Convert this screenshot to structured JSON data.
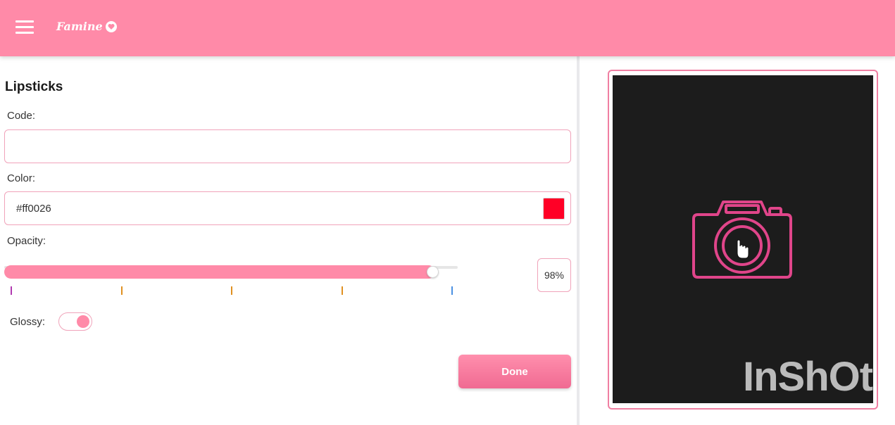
{
  "app": {
    "brand": "Famine",
    "brand_icon": "heart-icon"
  },
  "form": {
    "title": "Lipsticks",
    "code": {
      "label": "Code:",
      "value": ""
    },
    "color": {
      "label": "Color:",
      "value": "#ff0026",
      "swatch": "#ff0026"
    },
    "opacity": {
      "label": "Opacity:",
      "value": 0.98,
      "display": "98%",
      "tick_colors": [
        "#b03ab0",
        "#e09020",
        "#e09020",
        "#e09020",
        "#4a90e2"
      ]
    },
    "glossy": {
      "label": "Glossy:",
      "on": true
    },
    "done_label": "Done"
  },
  "preview": {
    "icon": "camera-icon",
    "cursor_icon": "hand-pointer-icon",
    "watermark": "InShOt"
  },
  "colors": {
    "accent": "#ff8aa8",
    "border": "#f0a3ba",
    "preview_bg": "#1c1c1c",
    "camera": "#e0458a"
  }
}
